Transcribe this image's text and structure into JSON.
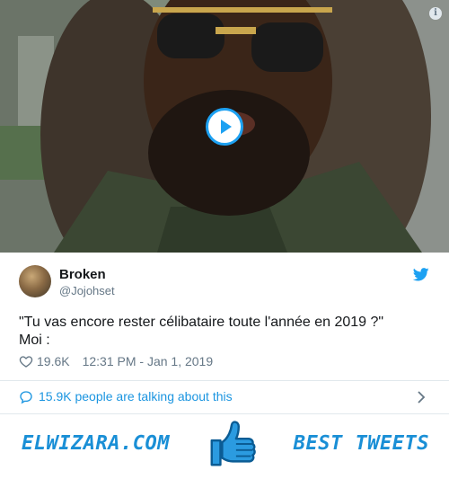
{
  "media": {
    "info_glyph": "i",
    "play_label": "Play video"
  },
  "tweet": {
    "user_name": "Broken",
    "user_handle": "@Jojohset",
    "text_line1": "\"Tu vas encore rester célibataire toute l'année en 2019 ?\"",
    "text_line2": "Moi :",
    "likes": "19.6K",
    "timestamp": "12:31 PM - Jan 1, 2019",
    "talking": "15.9K people are talking about this"
  },
  "banner": {
    "left_text": "ELWIZARA.COM",
    "right_text": "BEST TWEETS"
  },
  "colors": {
    "twitter_blue": "#1da1f2",
    "link_blue": "#1b95e0",
    "banner_blue": "#1a8fd6",
    "secondary_text": "#657786"
  },
  "icons": [
    "info-icon",
    "play-icon",
    "twitter-bird-icon",
    "heart-icon",
    "comment-icon",
    "chevron-right-icon",
    "thumbs-up-icon"
  ]
}
